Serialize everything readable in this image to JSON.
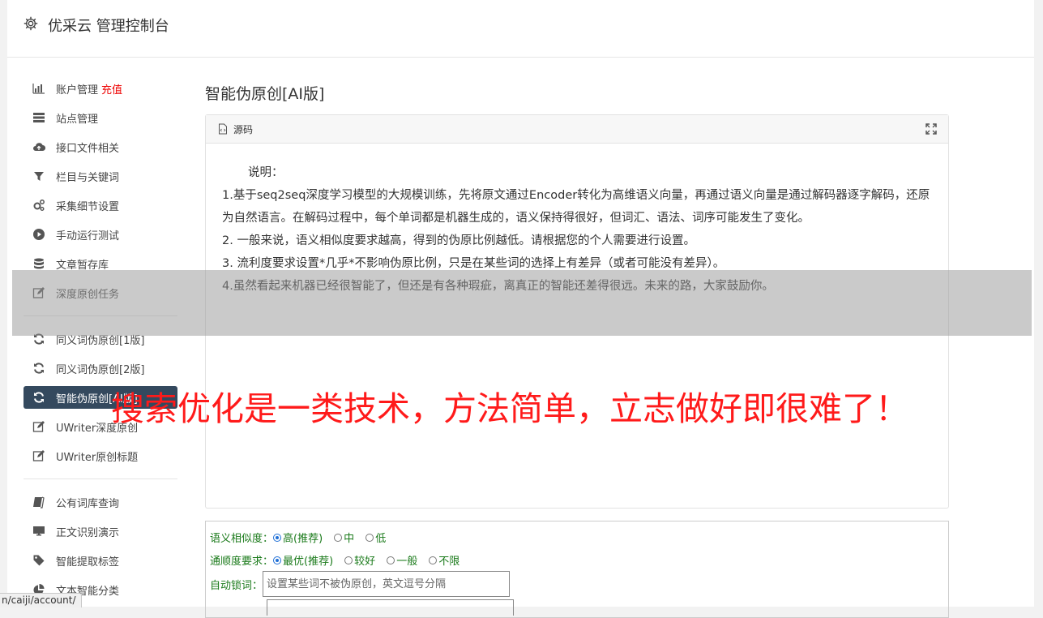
{
  "header": {
    "title": "优采云 管理控制台"
  },
  "sidebar": {
    "group1": [
      {
        "label": "账户管理",
        "badge": "充值",
        "icon": "bar-chart-icon"
      },
      {
        "label": "站点管理",
        "icon": "list-icon"
      },
      {
        "label": "接口文件相关",
        "icon": "cloud-upload-icon"
      },
      {
        "label": "栏目与关键词",
        "icon": "filter-icon"
      },
      {
        "label": "采集细节设置",
        "icon": "gears-icon"
      },
      {
        "label": "手动运行测试",
        "icon": "play-icon"
      },
      {
        "label": "文章暂存库",
        "icon": "database-icon"
      },
      {
        "label": "深度原创任务",
        "icon": "edit-icon"
      }
    ],
    "group2": [
      {
        "label": "同义词伪原创[1版]",
        "icon": "refresh-icon"
      },
      {
        "label": "同义词伪原创[2版]",
        "icon": "refresh-icon"
      },
      {
        "label": "智能伪原创[AI版]",
        "icon": "refresh-icon",
        "active": true
      },
      {
        "label": "UWriter深度原创",
        "icon": "edit-icon"
      },
      {
        "label": "UWriter原创标题",
        "icon": "edit-icon"
      }
    ],
    "group3": [
      {
        "label": "公有词库查询",
        "icon": "book-icon"
      },
      {
        "label": "正文识别演示",
        "icon": "monitor-icon"
      },
      {
        "label": "智能提取标签",
        "icon": "tag-icon"
      },
      {
        "label": "文本智能分类",
        "icon": "pie-icon"
      }
    ]
  },
  "content": {
    "title": "智能伪原创[AI版]",
    "editor": {
      "toolbar_label": "源码",
      "lines": [
        "说明：",
        "1.基于seq2seq深度学习模型的大规模训练，先将原文通过Encoder转化为高维语义向量，再通过语义向量是通过解码器逐字解码，还原为自然语言。在解码过程中，每个单词都是机器生成的，语义保持得很好，但词汇、语法、词序可能发生了变化。",
        "2. 一般来说，语义相似度要求越高，得到的伪原比例越低。请根据您的个人需要进行设置。",
        "3. 流利度要求设置*几乎*不影响伪原比例，只是在某些词的选择上有差异（或者可能没有差异）。",
        "4.虽然看起来机器已经很智能了，但还是有各种瑕疵，离真正的智能还差得很远。未来的路，大家鼓励你。"
      ]
    },
    "options": {
      "similarity": {
        "label": "语义相似度：",
        "choices": [
          "高(推荐)",
          "中",
          "低"
        ],
        "selected": 0
      },
      "fluency": {
        "label": "通顺度要求：",
        "choices": [
          "最优(推荐)",
          "较好",
          "一般",
          "不限"
        ],
        "selected": 0
      },
      "lock_words": {
        "label": "自动锁词：",
        "placeholder": "设置某些词不被伪原创，英文逗号分隔"
      }
    }
  },
  "overlay": {
    "slogan": "搜索优化是一类技术，方法简单，立志做好即很难了！"
  },
  "status_bar": {
    "url": "n/caiji/account/"
  }
}
